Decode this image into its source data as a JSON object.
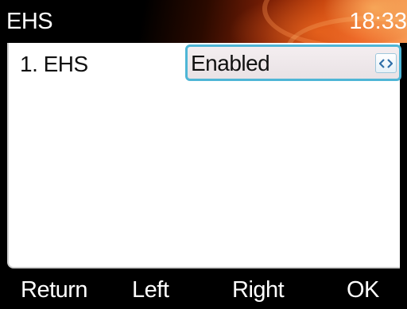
{
  "titlebar": {
    "title": "EHS",
    "time": "18:33"
  },
  "settings": {
    "items": [
      {
        "label": "1. EHS",
        "value": "Enabled",
        "switch_icon": "left-right-arrows-icon"
      }
    ]
  },
  "softkeys": {
    "return_label": "Return",
    "left_label": "Left",
    "right_label": "Right",
    "ok_label": "OK"
  },
  "colors": {
    "selection_border": "#4fb6d6",
    "arrow_icon": "#2f6fa8",
    "title_accent": "#e8652a"
  }
}
